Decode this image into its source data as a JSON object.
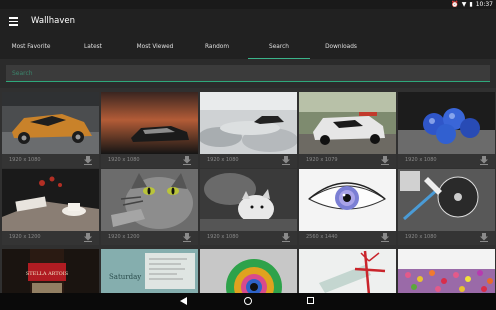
{
  "status": {
    "time": "10:37",
    "icons": [
      "alarm-icon",
      "wifi-icon",
      "battery-icon"
    ]
  },
  "app": {
    "title": "Wallhaven"
  },
  "tabs": [
    {
      "label": "Most Favorite",
      "active": false
    },
    {
      "label": "Latest",
      "active": false
    },
    {
      "label": "Most Viewed",
      "active": false
    },
    {
      "label": "Random",
      "active": false
    },
    {
      "label": "Search",
      "active": true
    },
    {
      "label": "Downloads",
      "active": false
    }
  ],
  "search": {
    "placeholder": "Search",
    "value": ""
  },
  "colors": {
    "accent": "#3bb38a",
    "appbar": "#212121",
    "background": "#303030"
  },
  "wallpapers": [
    {
      "resolution": "1920 x 1080",
      "theme": "sports-car-garage"
    },
    {
      "resolution": "1920 x 1080",
      "theme": "sunset-car"
    },
    {
      "resolution": "1920 x 1080",
      "theme": "car-clouds"
    },
    {
      "resolution": "1920 x 1079",
      "theme": "race-car-trees"
    },
    {
      "resolution": "1920 x 1080",
      "theme": "blue-berries"
    },
    {
      "resolution": "1920 x 1200",
      "theme": "coffee-table"
    },
    {
      "resolution": "1920 x 1200",
      "theme": "tabby-cat"
    },
    {
      "resolution": "1920 x 1080",
      "theme": "kitten-bw"
    },
    {
      "resolution": "2560 x 1440",
      "theme": "blue-eye"
    },
    {
      "resolution": "1920 x 1080",
      "theme": "dj-turntable"
    },
    {
      "resolution": "",
      "theme": "stella-artois"
    },
    {
      "resolution": "",
      "theme": "saturday-note"
    },
    {
      "resolution": "",
      "theme": "rainbow-eye"
    },
    {
      "resolution": "",
      "theme": "bottle-ribbon"
    },
    {
      "resolution": "",
      "theme": "flower-field"
    }
  ],
  "thumbnail_labels": {
    "saturday": "Saturday",
    "stella": "STELLA ARTOIS"
  }
}
